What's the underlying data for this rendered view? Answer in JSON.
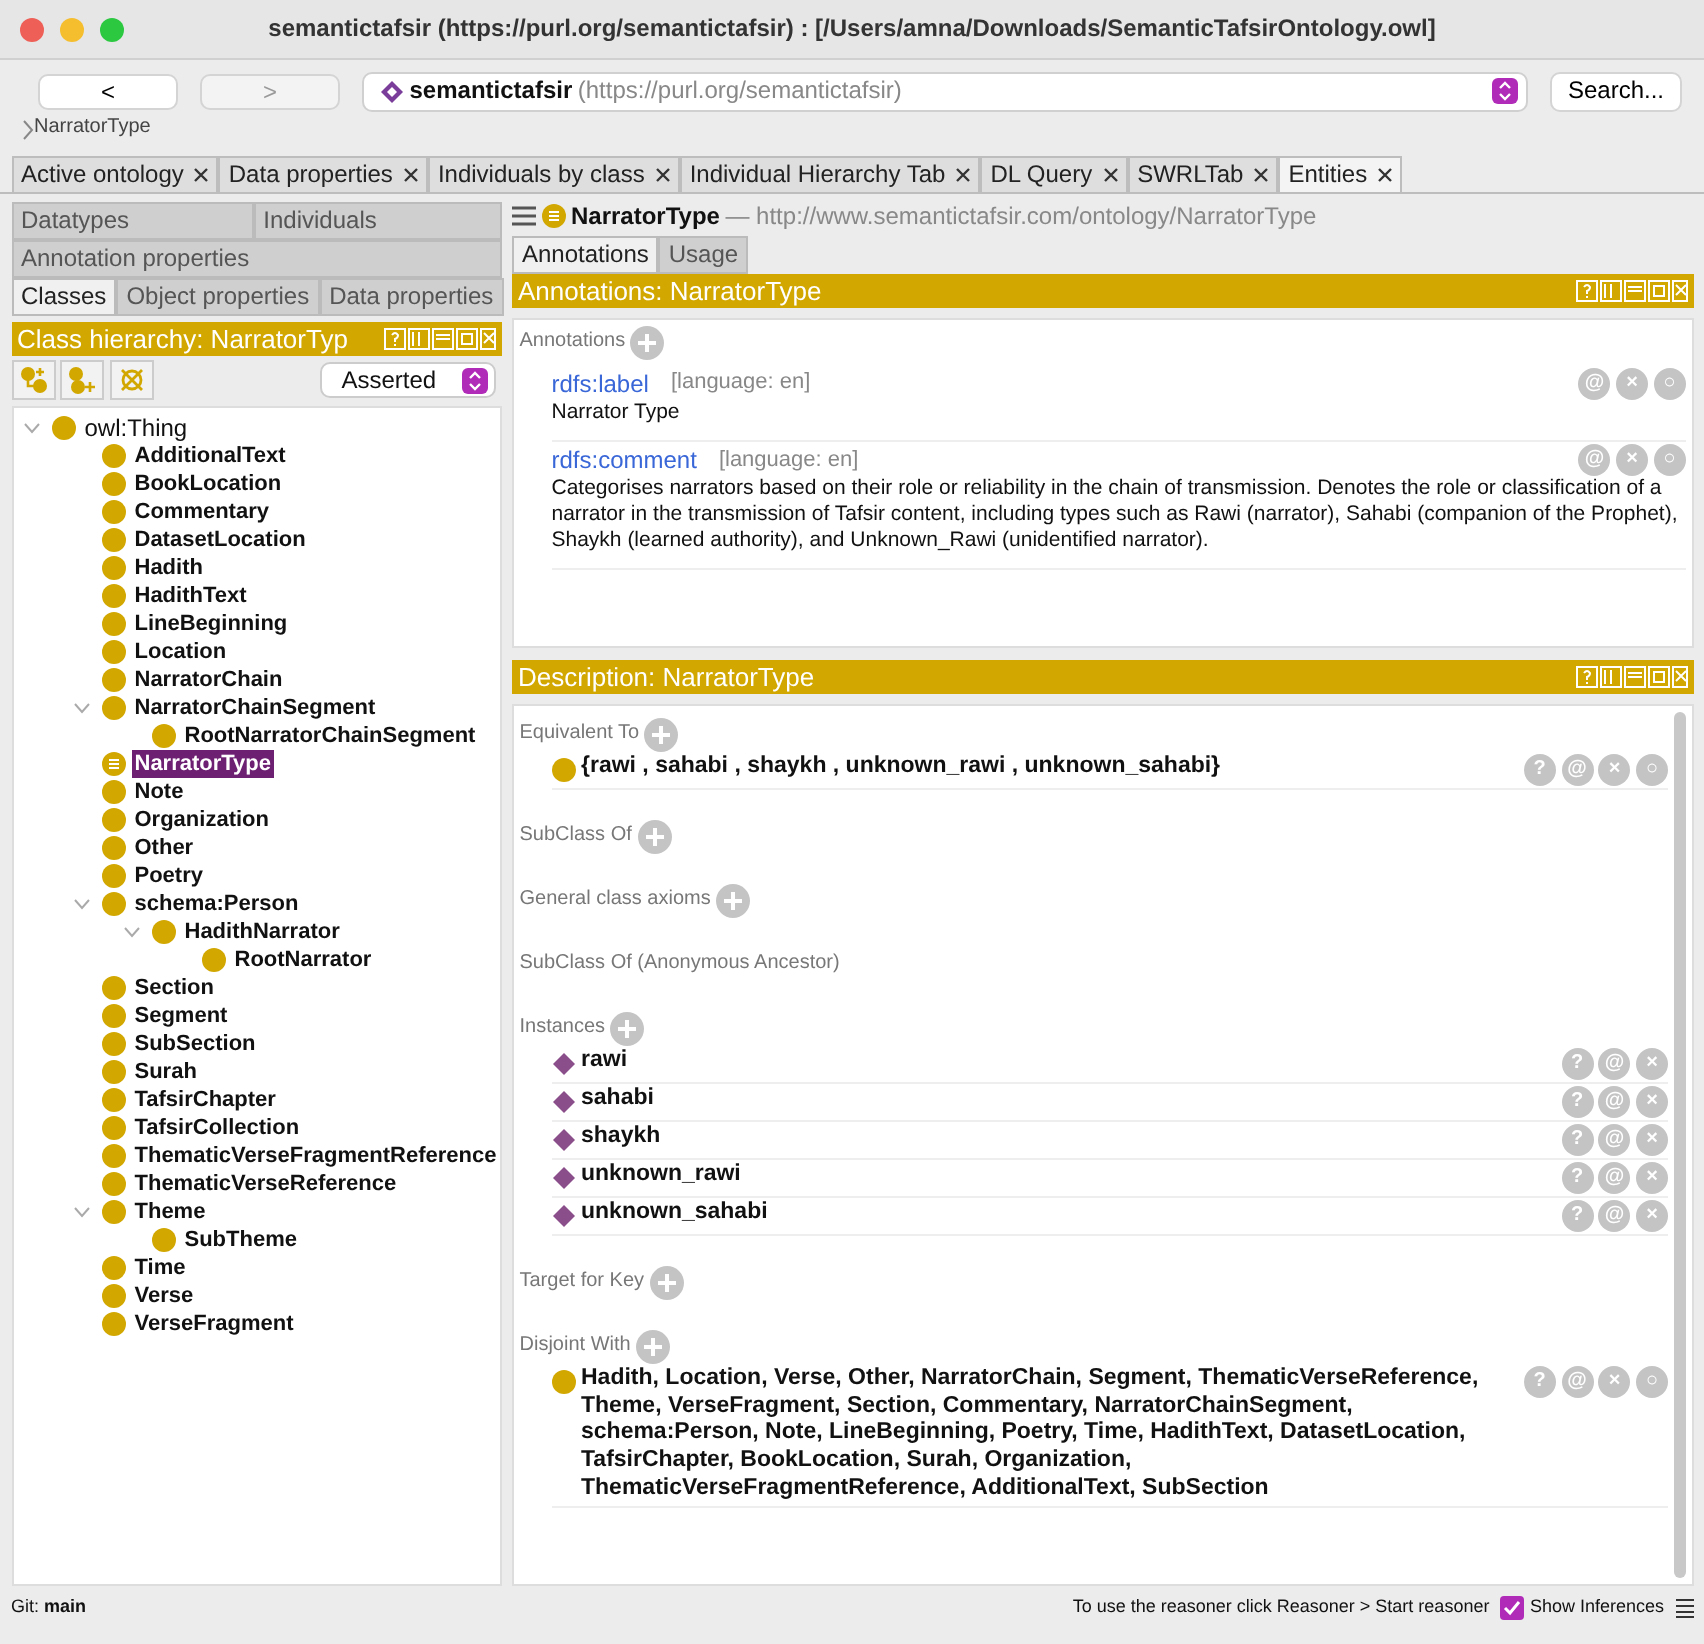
{
  "window": {
    "title": "semantictafsir (https://purl.org/semantictafsir)  : [/Users/amna/Downloads/SemanticTafsirOntology.owl]"
  },
  "nav": {
    "back": {
      "label": "<",
      "disabled": false
    },
    "forward": {
      "label": ">",
      "disabled": true
    },
    "address_name": "semantictafsir",
    "address_iri": "(https://purl.org/semantictafsir)",
    "search": "Search..."
  },
  "breadcrumb": "NarratorType",
  "tabs": [
    {
      "label": "Active ontology",
      "selected": false
    },
    {
      "label": "Data properties",
      "selected": false
    },
    {
      "label": "Individuals by class",
      "selected": false
    },
    {
      "label": "Individual Hierarchy Tab",
      "selected": false
    },
    {
      "label": "DL Query",
      "selected": false
    },
    {
      "label": "SWRLTab",
      "selected": false
    },
    {
      "label": "Entities",
      "selected": true
    }
  ],
  "entity_tab_rows": [
    [
      {
        "label": "Datatypes",
        "selected": false
      },
      {
        "label": "Individuals",
        "selected": false
      }
    ],
    [
      {
        "label": "Annotation properties",
        "selected": false
      }
    ],
    [
      {
        "label": "Classes",
        "selected": true
      },
      {
        "label": "Object properties",
        "selected": false
      },
      {
        "label": "Data properties",
        "selected": false
      }
    ]
  ],
  "class_hierarchy": {
    "title": "Class hierarchy: NarratorTyp",
    "mode": "Asserted",
    "tree": [
      {
        "label": "owl:Thing",
        "kind": "builtin",
        "selected": false,
        "expanded": true,
        "children": [
          {
            "label": "AdditionalText",
            "kind": "class",
            "selected": false
          },
          {
            "label": "BookLocation",
            "kind": "class",
            "selected": false
          },
          {
            "label": "Commentary",
            "kind": "class",
            "selected": false
          },
          {
            "label": "DatasetLocation",
            "kind": "class",
            "selected": false
          },
          {
            "label": "Hadith",
            "kind": "class",
            "selected": false
          },
          {
            "label": "HadithText",
            "kind": "class",
            "selected": false
          },
          {
            "label": "LineBeginning",
            "kind": "class",
            "selected": false
          },
          {
            "label": "Location",
            "kind": "class",
            "selected": false
          },
          {
            "label": "NarratorChain",
            "kind": "class",
            "selected": false
          },
          {
            "label": "NarratorChainSegment",
            "kind": "class",
            "selected": false,
            "expanded": true,
            "children": [
              {
                "label": "RootNarratorChainSegment",
                "kind": "class",
                "selected": false
              }
            ]
          },
          {
            "label": "NarratorType",
            "kind": "defined",
            "selected": true
          },
          {
            "label": "Note",
            "kind": "class",
            "selected": false
          },
          {
            "label": "Organization",
            "kind": "class",
            "selected": false
          },
          {
            "label": "Other",
            "kind": "class",
            "selected": false
          },
          {
            "label": "Poetry",
            "kind": "class",
            "selected": false
          },
          {
            "label": "schema:Person",
            "kind": "class",
            "selected": false,
            "expanded": true,
            "children": [
              {
                "label": "HadithNarrator",
                "kind": "class",
                "selected": false,
                "expanded": true,
                "children": [
                  {
                    "label": "RootNarrator",
                    "kind": "class",
                    "selected": false
                  }
                ]
              }
            ]
          },
          {
            "label": "Section",
            "kind": "class",
            "selected": false
          },
          {
            "label": "Segment",
            "kind": "class",
            "selected": false
          },
          {
            "label": "SubSection",
            "kind": "class",
            "selected": false
          },
          {
            "label": "Surah",
            "kind": "class",
            "selected": false
          },
          {
            "label": "TafsirChapter",
            "kind": "class",
            "selected": false
          },
          {
            "label": "TafsirCollection",
            "kind": "class",
            "selected": false
          },
          {
            "label": "ThematicVerseFragmentReference",
            "kind": "class",
            "selected": false
          },
          {
            "label": "ThematicVerseReference",
            "kind": "class",
            "selected": false
          },
          {
            "label": "Theme",
            "kind": "class",
            "selected": false,
            "expanded": true,
            "children": [
              {
                "label": "SubTheme",
                "kind": "class",
                "selected": false
              }
            ]
          },
          {
            "label": "Time",
            "kind": "class",
            "selected": false
          },
          {
            "label": "Verse",
            "kind": "class",
            "selected": false
          },
          {
            "label": "VerseFragment",
            "kind": "class",
            "selected": false
          }
        ]
      }
    ]
  },
  "entity": {
    "kind": "defined",
    "name": "NarratorType",
    "iri": "— http://www.semantictafsir.com/ontology/NarratorType",
    "tabs": [
      {
        "label": "Annotations",
        "selected": true
      },
      {
        "label": "Usage",
        "selected": false
      }
    ]
  },
  "annotations": {
    "title": "Annotations: NarratorType",
    "section": "Annotations",
    "items": [
      {
        "property": "rdfs:label",
        "language": "[language: en]",
        "value": "Narrator Type",
        "actions": [
          "@",
          "×",
          "○"
        ]
      },
      {
        "property": "rdfs:comment",
        "language": "[language: en]",
        "value": "Categorises narrators based on their role or reliability in the chain of transmission. Denotes the role or classification of a narrator in the transmission of Tafsir content, including types such as Rawi (narrator), Sahabi (companion of the Prophet), Shaykh (learned authority), and Unknown_Rawi (unidentified narrator).",
        "actions": [
          "@",
          "×",
          "○"
        ]
      }
    ]
  },
  "description": {
    "title": "Description: NarratorType",
    "sections": [
      {
        "label": "Equivalent To",
        "addable": true,
        "items": [
          {
            "kind": "class",
            "text": "{rawi , sahabi , shaykh , unknown_rawi , unknown_sahabi}",
            "actions": [
              "?",
              "@",
              "×",
              "○"
            ]
          }
        ]
      },
      {
        "label": "SubClass Of",
        "addable": true
      },
      {
        "label": "General class axioms",
        "addable": true
      },
      {
        "label": "SubClass Of (Anonymous Ancestor)",
        "addable": false
      },
      {
        "label": "Instances",
        "addable": true,
        "items": [
          {
            "kind": "individual",
            "text": "rawi",
            "actions": [
              "?",
              "@",
              "×"
            ]
          },
          {
            "kind": "individual",
            "text": "sahabi",
            "actions": [
              "?",
              "@",
              "×"
            ]
          },
          {
            "kind": "individual",
            "text": "shaykh",
            "actions": [
              "?",
              "@",
              "×"
            ]
          },
          {
            "kind": "individual",
            "text": "unknown_rawi",
            "actions": [
              "?",
              "@",
              "×"
            ]
          },
          {
            "kind": "individual",
            "text": "unknown_sahabi",
            "actions": [
              "?",
              "@",
              "×"
            ]
          }
        ]
      },
      {
        "label": "Target for Key",
        "addable": true
      },
      {
        "label": "Disjoint With",
        "addable": true,
        "items": [
          {
            "kind": "class",
            "text": "Hadith, Location, Verse, Other, NarratorChain, Segment, ThematicVerseReference, Theme, VerseFragment, Section, Commentary, NarratorChainSegment, schema:Person, Note, LineBeginning, Poetry, Time, HadithText, DatasetLocation, TafsirChapter, BookLocation, Surah, Organization, ThematicVerseFragmentReference, AdditionalText, SubSection",
            "actions": [
              "?",
              "@",
              "×",
              "○"
            ]
          }
        ]
      }
    ]
  },
  "status_bar": {
    "git": "Git: **main**",
    "hint": "To use the reasoner click Reasoner > Start reasoner",
    "show_inferences": {
      "label": "Show Inferences",
      "checked": true
    }
  }
}
